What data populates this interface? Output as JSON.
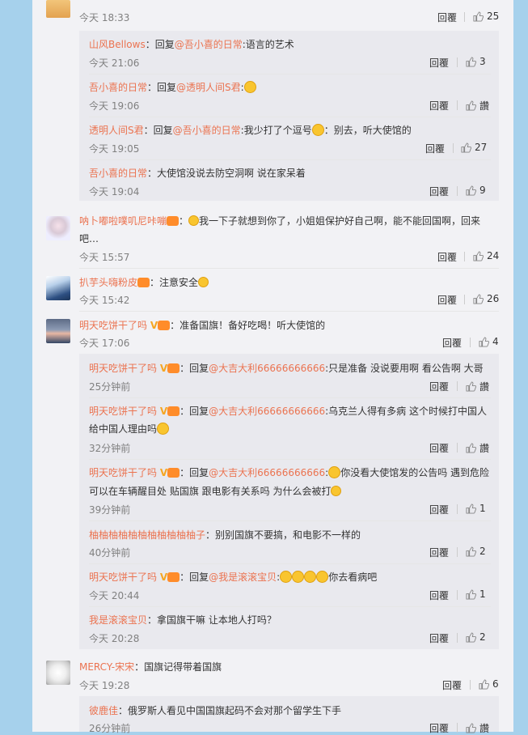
{
  "labels": {
    "reply": "回覆",
    "like_text": "讚"
  },
  "top": {
    "time": "今天 18:33",
    "likes": "25"
  },
  "top_replies": [
    {
      "name": "山风Bellows",
      "pre": "：回复",
      "mention": "@吾小喜的日常",
      "text": ":语言的艺术",
      "time": "今天 21:06",
      "likes": "3"
    },
    {
      "name": "吾小喜的日常",
      "pre": "：回复",
      "mention": "@透明人间S君",
      "text": ":",
      "time": "今天 19:06",
      "likes": "讚"
    },
    {
      "name": "透明人间S君",
      "pre": "：回复",
      "mention": "@吾小喜的日常",
      "text": ":我少打了个逗号",
      "text2": "：别去，听大使馆的",
      "time": "今天 19:05",
      "likes": "27"
    },
    {
      "name": "吾小喜的日常",
      "pre": "：大使馆没说去防空洞啊 说在家呆着",
      "mention": "",
      "text": "",
      "time": "今天 19:04",
      "likes": "9"
    }
  ],
  "comments": [
    {
      "name": "呐卜嘟啦噗叽尼咔嘣",
      "text": "：",
      "text_line1": "我一下子就想到你了，小姐姐保护好自己啊，能不能回国啊，回来",
      "text_line2": "吧…",
      "time": "今天 15:57",
      "likes": "24"
    },
    {
      "name": "扒芋头嗨粉皮",
      "text": "：注意安全",
      "time": "今天 15:42",
      "likes": "26"
    },
    {
      "name": "明天吃饼干了吗",
      "text": "：准备国旗！备好吃喝！听大使馆的",
      "time": "今天 17:06",
      "likes": "4"
    }
  ],
  "sub_replies": [
    {
      "name": "明天吃饼干了吗",
      "pre": "：回复",
      "mention": "@大吉大利66666666666",
      "text": ":只是准备 没说要用啊 看公告啊 大哥",
      "time": "25分钟前",
      "likes": "讚"
    },
    {
      "name": "明天吃饼干了吗",
      "pre": "：回复",
      "mention": "@大吉大利66666666666",
      "text": ":乌克兰人得有多病 这个时候打中国人",
      "text_line2": "给中国人理由吗",
      "time": "32分钟前",
      "likes": "讚"
    },
    {
      "name": "明天吃饼干了吗",
      "pre": "：回复",
      "mention": "@大吉大利66666666666",
      "text": "你没看大使馆发的公告吗 遇到危险",
      "text_line2": "可以在车辆醒目处 贴国旗 跟电影有关系吗 为什么会被打",
      "time": "39分钟前",
      "likes": "1"
    },
    {
      "name": "柚柚柚柚柚柚柚柚柚柚柚子",
      "pre": "：别别国旗不要搞，和电影不一样的",
      "mention": "",
      "text": "",
      "time": "40分钟前",
      "likes": "2"
    },
    {
      "name": "明天吃饼干了吗",
      "pre": "：回复",
      "mention": "@我是滚滚宝贝",
      "text": ":",
      "text2": "你去看病吧",
      "time": "今天 20:44",
      "likes": "1"
    },
    {
      "name": "我是滚滚宝贝",
      "pre": "：拿国旗干嘛 让本地人打吗？",
      "mention": "",
      "text": "",
      "time": "今天 20:28",
      "likes": "2"
    }
  ],
  "last_comment": {
    "name": "MERCY-宋宋",
    "text": "：国旗记得带着国旗",
    "time": "今天 19:28",
    "likes": "6"
  },
  "last_reply": {
    "name": "彼鹿佳",
    "text": "：俄罗斯人看见中国国旗起码不会对那个留学生下手",
    "time": "26分钟前",
    "likes": "讚"
  }
}
